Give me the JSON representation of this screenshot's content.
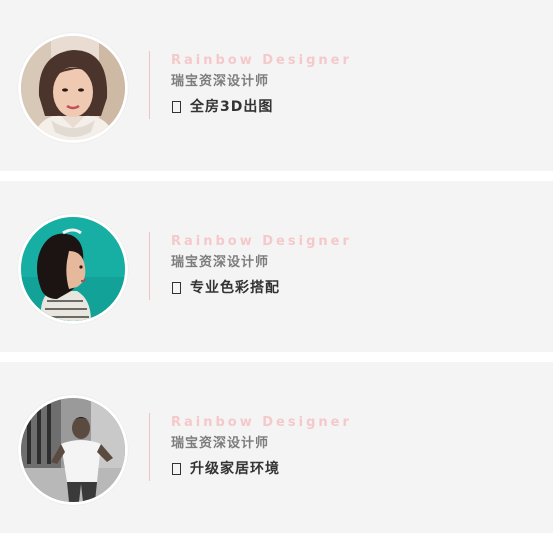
{
  "designers": [
    {
      "title_en": "Rainbow Designer",
      "role": "瑞宝资深设计师",
      "specialty": "全房3D出图",
      "specialty_icon": "tofu-glyph-icon",
      "avatar_desc": "woman-portrait-white-scarf"
    },
    {
      "title_en": "Rainbow Designer",
      "role": "瑞宝资深设计师",
      "specialty": "专业色彩搭配",
      "specialty_icon": "tofu-glyph-icon",
      "avatar_desc": "woman-profile-teal-background"
    },
    {
      "title_en": "Rainbow Designer",
      "role": "瑞宝资深设计师",
      "specialty": "升级家居环境",
      "specialty_icon": "tofu-glyph-icon",
      "avatar_desc": "man-white-tshirt-grayscale"
    }
  ],
  "colors": {
    "card_bg": "#f4f4f4",
    "title_en": "#f5c9cb",
    "divider": "#efc2c3",
    "role": "#7d7d7d",
    "specialty": "#333333"
  }
}
